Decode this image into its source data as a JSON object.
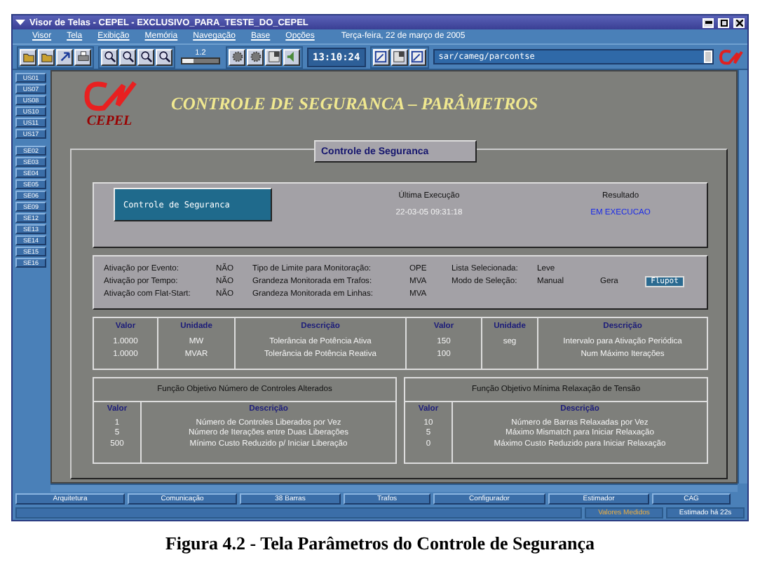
{
  "window": {
    "title": "Visor de Telas - CEPEL - EXCLUSIVO_PARA_TESTE_DO_CEPEL"
  },
  "menu": {
    "items": [
      "Visor",
      "Tela",
      "Exibição",
      "Memória",
      "Navegação",
      "Base",
      "Opções"
    ],
    "date": "Terça-feira, 22 de março de 2005"
  },
  "toolbar": {
    "zoom_reading": "1.2",
    "level": 0.3,
    "clock": "13:10:24",
    "path": "sar/cameg/parcontse"
  },
  "sidebar": {
    "groups": [
      [
        "US01",
        "US07",
        "US08",
        "US10",
        "US11",
        "US17"
      ],
      [
        "SE02",
        "SE03",
        "SE04",
        "SE05",
        "SE06",
        "SE09",
        "SE12",
        "SE13",
        "SE14",
        "SE15",
        "SE16"
      ]
    ]
  },
  "header": {
    "logo_text": "CEPEL",
    "title": "CONTROLE DE SEGURANCA – PARÂMETROS"
  },
  "section_tab": "Controle de Seguranca",
  "status_panel": {
    "button": "Controle de Seguranca",
    "last_run_label": "Última Execução",
    "last_run_value": "22-03-05 09:31:18",
    "result_label": "Resultado",
    "result_value": "EM EXECUCAO"
  },
  "params": {
    "rows": [
      [
        "Ativação por Evento:",
        "NÃO",
        "Tipo de Limite para Monitoração:",
        "OPE",
        "Lista Selecionada:",
        "Leve"
      ],
      [
        "Ativação por Tempo:",
        "NÃO",
        "Grandeza Monitorada em Trafos:",
        "MVA",
        "Modo de Seleção:",
        "Manual"
      ],
      [
        "Ativação com Flat-Start:",
        "NÃO",
        "Grandeza Monitorada em Linhas:",
        "MVA",
        "",
        ""
      ]
    ],
    "gera_label": "Gera",
    "gera_button": "Flupot"
  },
  "tolerance_table": {
    "columns": [
      "Valor",
      "Unidade",
      "Descrição",
      "Valor",
      "Unidade",
      "Descrição"
    ],
    "rows": [
      [
        "1.0000",
        "MW",
        "Tolerância de Potência Ativa",
        "150",
        "seg",
        "Intervalo para Ativação Periódica"
      ],
      [
        "1.0000",
        "MVAR",
        "Tolerância de Potência Reativa",
        "100",
        "",
        "Num Máximo Iterações"
      ]
    ]
  },
  "objective_panels": [
    {
      "title": "Função Objetivo Número de Controles Alterados",
      "columns": [
        "Valor",
        "Descrição"
      ],
      "rows": [
        [
          "1",
          "Número de Controles Liberados por Vez"
        ],
        [
          "5",
          "Número de Iterações entre Duas Liberações"
        ],
        [
          "500",
          "Mínimo Custo Reduzido p/ Iniciar Liberação"
        ]
      ]
    },
    {
      "title": "Função Objetivo Mínima Relaxação de Tensão",
      "columns": [
        "Valor",
        "Descrição"
      ],
      "rows": [
        [
          "10",
          "Número de Barras Relaxadas por Vez"
        ],
        [
          "5",
          "Máximo Mismatch para Iniciar Relaxação"
        ],
        [
          "0",
          "Máximo Custo Reduzido para Iniciar Relaxação"
        ]
      ]
    }
  ],
  "bottom_tabs": [
    "Arquitetura",
    "Comunicação",
    "38 Barras",
    "Trafos",
    "Configurador",
    "Estimador",
    "CAG"
  ],
  "status_bar": [
    "Valores Medidos",
    "Estimado há 22s"
  ],
  "caption": "Figura 4.2 - Tela Parâmetros do Controle de Segurança"
}
